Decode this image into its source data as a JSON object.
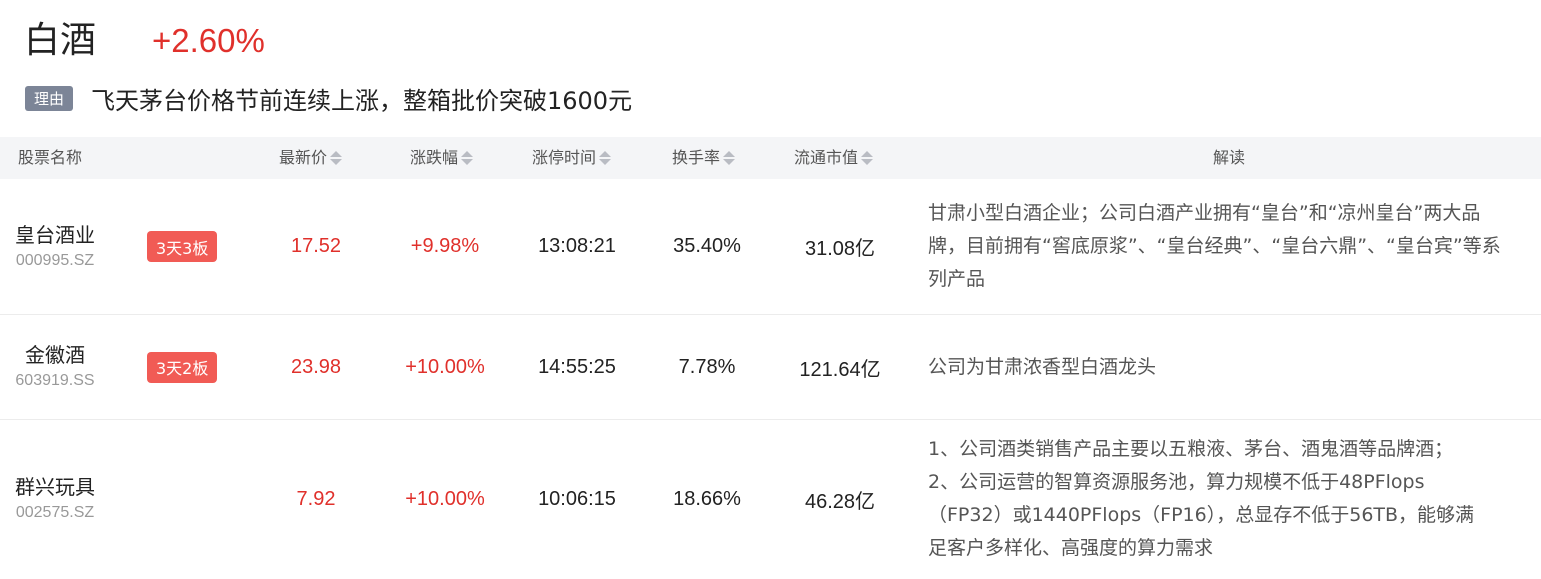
{
  "header": {
    "sector_name": "白酒",
    "sector_change": "+2.60%",
    "reason_tag": "理由",
    "reason_text": "飞天茅台价格节前连续上涨，整箱批价突破1600元"
  },
  "table": {
    "columns": {
      "name": "股票名称",
      "price": "最新价",
      "change": "涨跌幅",
      "limit_time": "涨停时间",
      "turnover": "换手率",
      "market_cap": "流通市值",
      "note": "解读"
    },
    "rows": [
      {
        "name": "皇台酒业",
        "code": "000995.SZ",
        "badge": "3天3板",
        "price": "17.52",
        "change": "+9.98%",
        "limit_time": "13:08:21",
        "turnover": "35.40%",
        "market_cap": "31.08亿",
        "note_lines": [
          "甘肃小型白酒企业；公司白酒产业拥有“皇台”和“凉州皇台”两大品",
          "牌，目前拥有“窖底原浆”、“皇台经典”、“皇台六鼎”、“皇台宾”等系",
          "列产品"
        ]
      },
      {
        "name": "金徽酒",
        "code": "603919.SS",
        "badge": "3天2板",
        "price": "23.98",
        "change": "+10.00%",
        "limit_time": "14:55:25",
        "turnover": "7.78%",
        "market_cap": "121.64亿",
        "note_lines": [
          "公司为甘肃浓香型白酒龙头"
        ]
      },
      {
        "name": "群兴玩具",
        "code": "002575.SZ",
        "badge": "",
        "price": "7.92",
        "change": "+10.00%",
        "limit_time": "10:06:15",
        "turnover": "18.66%",
        "market_cap": "46.28亿",
        "note_lines": [
          "1、公司酒类销售产品主要以五粮液、茅台、酒鬼酒等品牌酒；",
          "2、公司运营的智算资源服务池，算力规模不低于48PFlops",
          "（FP32）或1440PFlops（FP16），总显存不低于56TB，能够满",
          "足客户多样化、高强度的算力需求"
        ]
      }
    ]
  },
  "colors": {
    "up_red": "#e0302b",
    "badge_red": "#f15b55",
    "tag_gray": "#7c8597",
    "header_bg": "#f4f5f7"
  },
  "icons": {
    "sort": "sort-caret-icon"
  }
}
